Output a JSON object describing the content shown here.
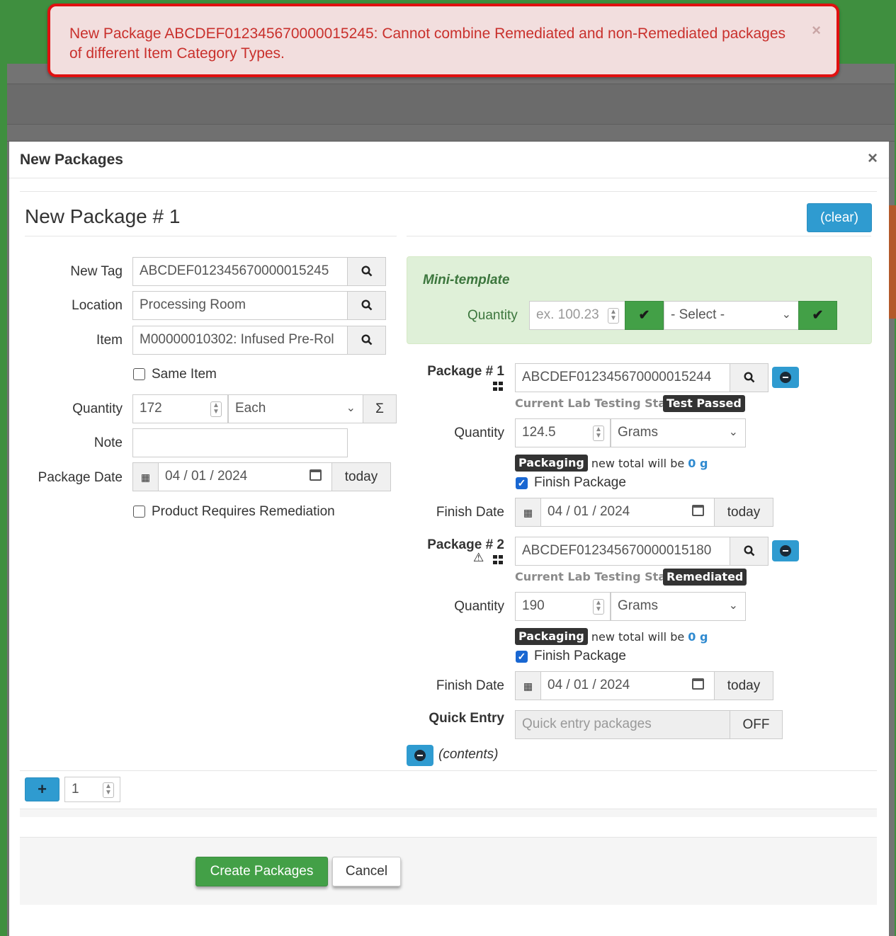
{
  "alert": {
    "message": "New Package ABCDEF012345670000015245: Cannot combine Remediated and non-Remediated packages of different Item Category Types.",
    "close": "×"
  },
  "modal": {
    "title": "New Packages",
    "close": "×"
  },
  "package": {
    "heading": "New Package # 1",
    "clear_label": "(clear)",
    "new_tag_label": "New Tag",
    "new_tag_value": "ABCDEF012345670000015245",
    "location_label": "Location",
    "location_value": "Processing Room",
    "item_label": "Item",
    "item_value": "M00000010302: Infused Pre-Rol",
    "same_item_label": "Same Item",
    "quantity_label": "Quantity",
    "quantity_value": "172",
    "unit_value": "Each",
    "sigma": "Σ",
    "note_label": "Note",
    "note_value": "",
    "package_date_label": "Package Date",
    "package_date_value": "04 / 01 / 2024",
    "today_label": "today",
    "remediation_label": "Product Requires Remediation"
  },
  "mini_template": {
    "title": "Mini-template",
    "quantity_label": "Quantity",
    "quantity_placeholder": "ex. 100.23",
    "select_value": "- Select -"
  },
  "sources": [
    {
      "label": "Package # 1",
      "tag": "ABCDEF012345670000015244",
      "lab_state_label": "Current Lab Testing State:",
      "lab_state": "Test Passed",
      "quantity_label": "Quantity",
      "quantity": "124.5",
      "unit": "Grams",
      "packaging_badge": "Packaging",
      "new_total_text": "- new total will be",
      "new_total_value": "0 g",
      "finish_label": "Finish Package",
      "finish_date_label": "Finish Date",
      "finish_date": "04 / 01 / 2024",
      "today_label": "today"
    },
    {
      "label": "Package # 2",
      "tag": "ABCDEF012345670000015180",
      "lab_state_label": "Current Lab Testing State:",
      "lab_state": "Remediated",
      "quantity_label": "Quantity",
      "quantity": "190",
      "unit": "Grams",
      "packaging_badge": "Packaging",
      "new_total_text": "- new total will be",
      "new_total_value": "0 g",
      "finish_label": "Finish Package",
      "finish_date_label": "Finish Date",
      "finish_date": "04 / 01 / 2024",
      "today_label": "today"
    }
  ],
  "quick_entry": {
    "label": "Quick Entry",
    "placeholder": "Quick entry packages",
    "toggle": "OFF"
  },
  "contents_label": "(contents)",
  "add_count": "1",
  "footer": {
    "create_label": "Create Packages",
    "cancel_label": "Cancel"
  }
}
